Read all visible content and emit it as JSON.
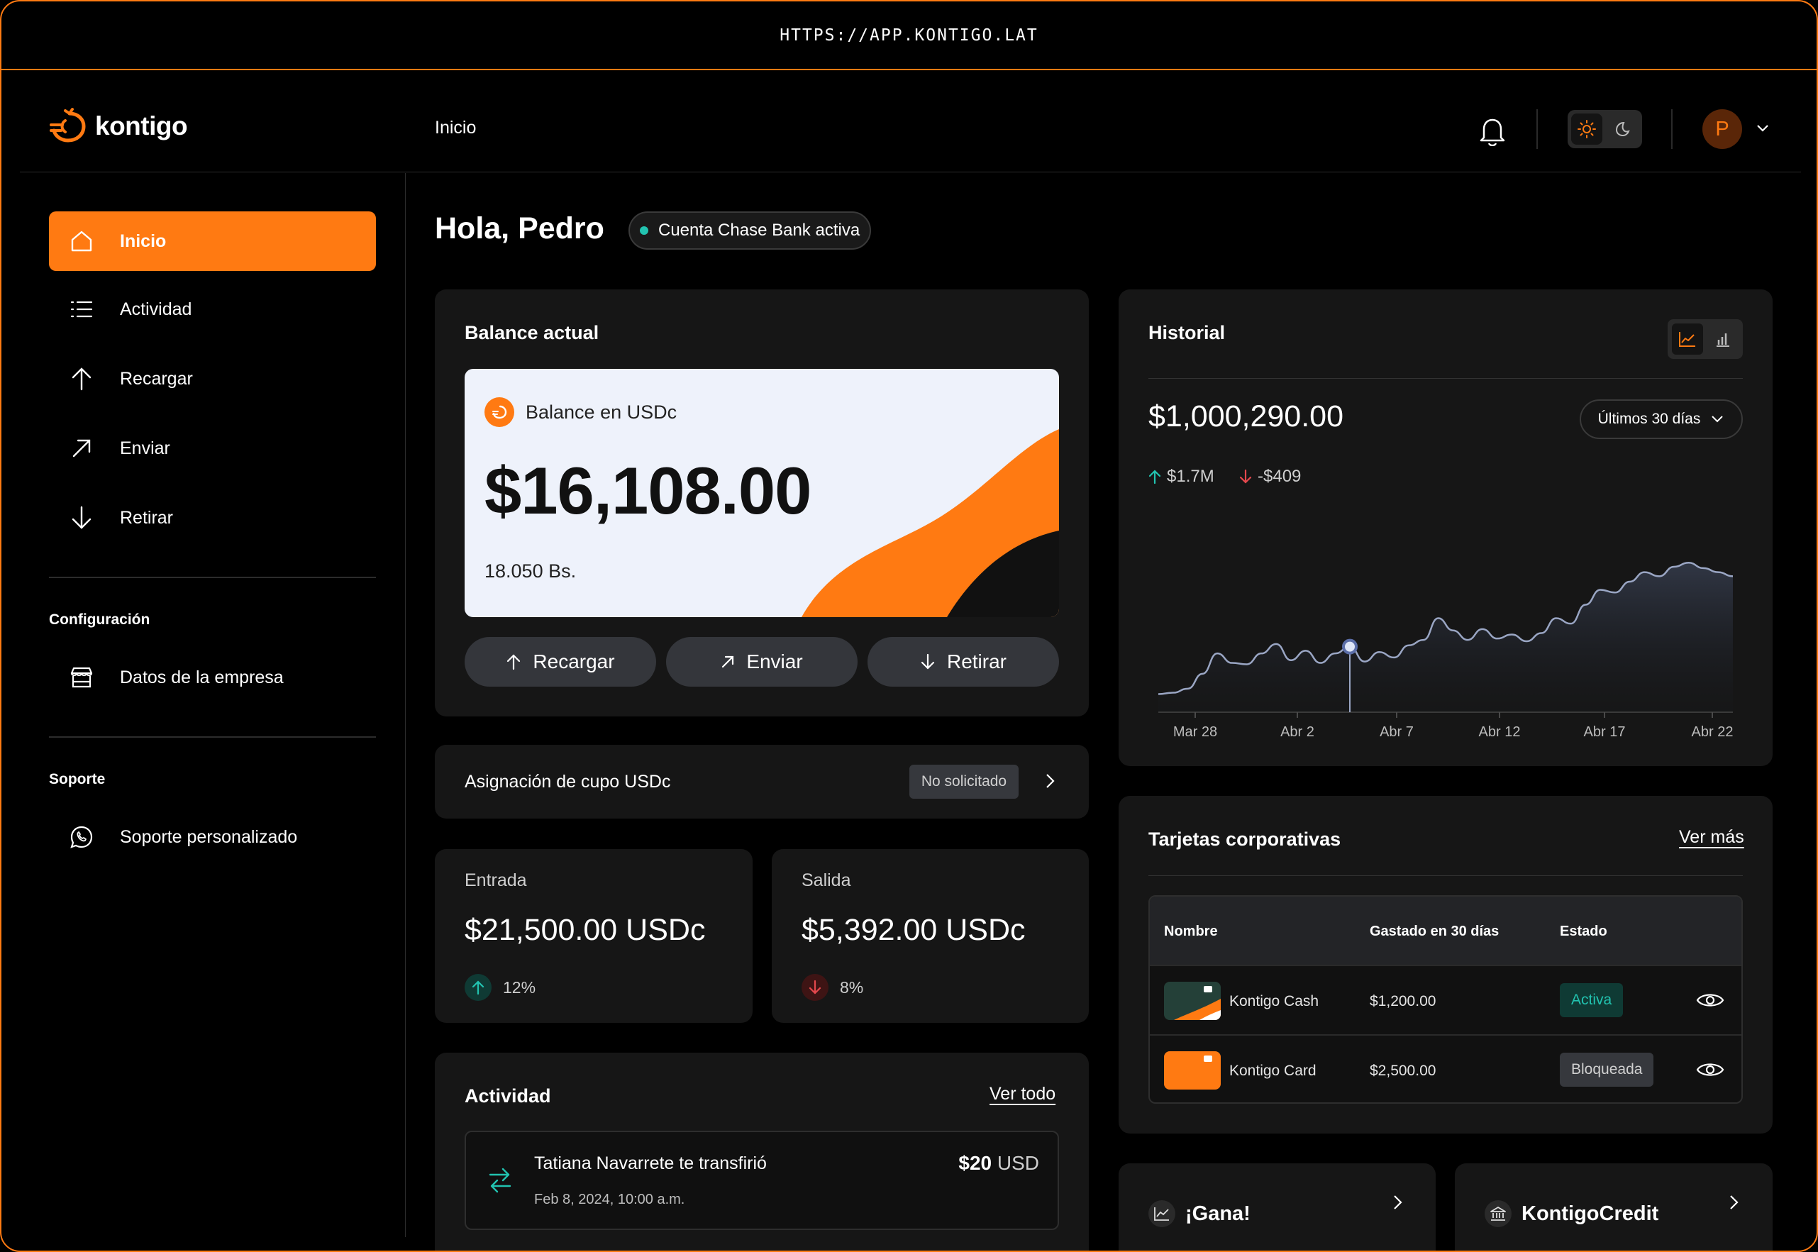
{
  "browser": {
    "url": "HTTPS://APP.KONTIGO.LAT"
  },
  "brand": {
    "name": "kontigo",
    "accent": "#ff7a12"
  },
  "header": {
    "breadcrumb": "Inicio",
    "avatar_initial": "P"
  },
  "sidebar": {
    "main_items": [
      {
        "label": "Inicio",
        "icon": "home-icon",
        "active": true
      },
      {
        "label": "Actividad",
        "icon": "list-icon"
      },
      {
        "label": "Recargar",
        "icon": "arrow-up-icon"
      },
      {
        "label": "Enviar",
        "icon": "arrow-up-right-icon"
      },
      {
        "label": "Retirar",
        "icon": "arrow-down-icon"
      }
    ],
    "config_heading": "Configuración",
    "config_items": [
      {
        "label": "Datos de la empresa",
        "icon": "store-icon"
      }
    ],
    "support_heading": "Soporte",
    "support_items": [
      {
        "label": "Soporte personalizado",
        "icon": "whatsapp-icon"
      }
    ]
  },
  "main": {
    "greeting": "Hola, Pedro",
    "bank_status": "Cuenta Chase Bank activa",
    "balance": {
      "title": "Balance actual",
      "label": "Balance en USDc",
      "amount": "$16,108.00",
      "secondary": "18.050 Bs.",
      "actions": [
        "Recargar",
        "Enviar",
        "Retirar"
      ]
    },
    "cupo": {
      "label": "Asignación de cupo USDc",
      "badge": "No solicitado"
    },
    "entrada": {
      "label": "Entrada",
      "amount": "$21,500.00 USDc",
      "pct": "12%"
    },
    "salida": {
      "label": "Salida",
      "amount": "$5,392.00 USDc",
      "pct": "8%"
    },
    "actividad": {
      "title": "Actividad",
      "link": "Ver todo",
      "items": [
        {
          "title": "Tatiana Navarrete te transfirió",
          "date": "Feb 8, 2024, 10:00 a.m.",
          "amount": "$20",
          "currency": "USD"
        }
      ]
    },
    "historial": {
      "title": "Historial",
      "total": "$1,000,290.00",
      "range": "Últimos 30 días",
      "up": "$1.7M",
      "down": "-$409",
      "x_labels": [
        "Mar 28",
        "Abr 2",
        "Abr 7",
        "Abr 12",
        "Abr 17",
        "Abr 22"
      ]
    },
    "tarjetas": {
      "title": "Tarjetas corporativas",
      "link": "Ver más",
      "columns": [
        "Nombre",
        "Gastado en 30 días",
        "Estado"
      ],
      "rows": [
        {
          "name": "Kontigo Cash",
          "spent": "$1,200.00",
          "status": "Activa"
        },
        {
          "name": "Kontigo Card",
          "spent": "$2,500.00",
          "status": "Bloqueada"
        }
      ]
    },
    "promo": {
      "gana": "¡Gana!",
      "credit": "KontigoCredit"
    }
  },
  "chart_data": {
    "type": "area",
    "x": [
      "Mar 28",
      "Abr 2",
      "Abr 7",
      "Abr 12",
      "Abr 17",
      "Abr 22"
    ],
    "values": [
      5,
      6,
      9,
      20,
      35,
      28,
      27,
      35,
      42,
      30,
      37,
      28,
      35,
      40,
      29,
      36,
      32,
      41,
      45,
      61,
      52,
      45,
      53,
      46,
      49,
      44,
      50,
      61,
      57,
      71,
      82,
      80,
      88,
      95,
      92,
      99,
      102,
      98,
      95,
      92
    ],
    "highlight_index": 13,
    "grid": false,
    "legend": "none"
  }
}
